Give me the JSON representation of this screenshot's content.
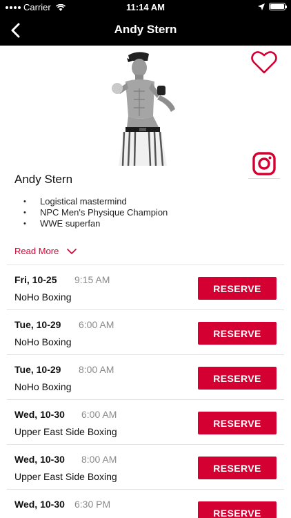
{
  "status_bar": {
    "carrier": "Carrier",
    "time": "11:14 AM"
  },
  "nav": {
    "title": "Andy Stern"
  },
  "profile": {
    "name": "Andy Stern",
    "bio": [
      "Logistical mastermind",
      "NPC Men's Physique Champion",
      "WWE superfan"
    ],
    "read_more": "Read More"
  },
  "sessions": [
    {
      "date": "Fri, 10-25",
      "time": "9:15 AM",
      "location": "NoHo Boxing",
      "button": "RESERVE"
    },
    {
      "date": "Tue, 10-29",
      "time": "6:00 AM",
      "location": "NoHo Boxing",
      "button": "RESERVE"
    },
    {
      "date": "Tue, 10-29",
      "time": "8:00 AM",
      "location": "NoHo Boxing",
      "button": "RESERVE"
    },
    {
      "date": "Wed, 10-30",
      "time": "6:00 AM",
      "location": "Upper East Side Boxing",
      "button": "RESERVE"
    },
    {
      "date": "Wed, 10-30",
      "time": "8:00 AM",
      "location": "Upper East Side Boxing",
      "button": "RESERVE"
    },
    {
      "date": "Wed, 10-30",
      "time": "6:30 PM",
      "location": "",
      "button": "RESERVE"
    }
  ],
  "icons": {
    "back": "chevron-left-icon",
    "favorite": "heart-icon",
    "social": "instagram-icon",
    "expand": "chevron-down-icon"
  },
  "colors": {
    "accent": "#d50032",
    "nav_background": "#000000"
  }
}
